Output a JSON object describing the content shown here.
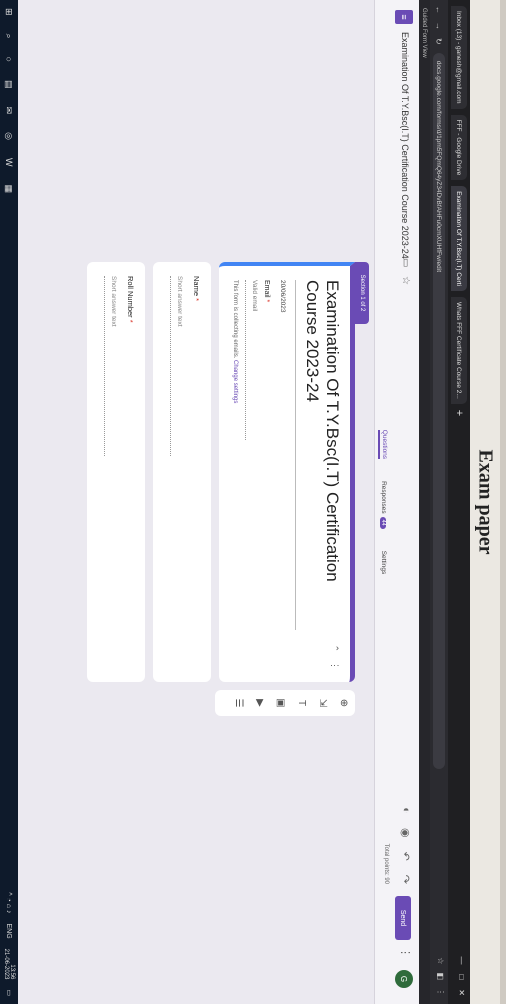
{
  "page_heading": "Exam paper",
  "browser": {
    "tabs": [
      {
        "label": "Inbox (13) - ganesh@gmail.com",
        "active": false
      },
      {
        "label": "FFF - Google Drive",
        "active": false
      },
      {
        "label": "Examination Of T.Y.Bsc(I.T) Certi",
        "active": true
      },
      {
        "label": "Whats FFF Certificate Course 2...",
        "active": false
      }
    ],
    "new_tab": "+",
    "url": "docs.google.com/forms/d/1pm5FQmQ64yZ34DvBfAHFu0cmXUHfFw/edit",
    "bookmark": "Guided Form View"
  },
  "app": {
    "form_title": "Examination Of T.Y.Bsc(I.T) Certification Course 2023-24",
    "send_label": "Send",
    "profile_initial": "G",
    "tabs": [
      {
        "label": "Questions",
        "active": true
      },
      {
        "label": "Responses",
        "active": false,
        "badge": "44"
      },
      {
        "label": "Settings",
        "active": false
      }
    ],
    "total_points": "Total points: 90"
  },
  "form": {
    "section_label": "Section 1 of 2",
    "title": "Examination Of T.Y.Bsc(I.T) Certification Course 2023-24",
    "date": "20/06/2023",
    "email_label": "Email",
    "required_mark": "*",
    "email_placeholder": "Valid email",
    "collect_note": "This form is collecting emails.",
    "change_settings": "Change settings",
    "questions": [
      {
        "label": "Name",
        "placeholder": "Short answer text"
      },
      {
        "label": "Roll Number",
        "placeholder": "Short answer text"
      }
    ]
  },
  "taskbar": {
    "language": "ENG",
    "time": "13:56",
    "date": "21-06-2023"
  }
}
